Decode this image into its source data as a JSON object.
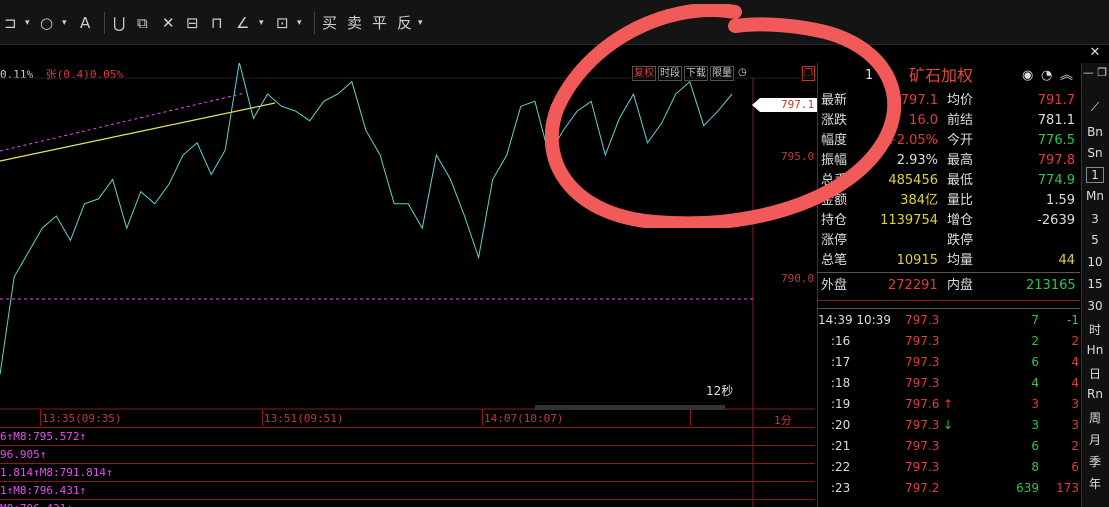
{
  "toolbar": {
    "trade_buttons": [
      "买",
      "卖",
      "平",
      "反"
    ]
  },
  "chart": {
    "header_pct": "0.11%",
    "header_zhang": "张(0.4)0.05%",
    "mini_buttons": [
      "复权",
      "时段",
      "下载",
      "限量"
    ],
    "price_tag": "797.1",
    "price_axis": [
      "795.0",
      "790.0"
    ],
    "time_axis": [
      "13:35(09:35)",
      "13:51(09:51)",
      "14:07(10:07)",
      "1分"
    ],
    "countdown": "12秒",
    "indicator_rows": [
      "6↑M8:795.572↑",
      "96.905↑",
      "1.814↑M8:791.814↑",
      "1↑M8:796.431↑",
      "M8:796.431↑"
    ],
    "series": {
      "price": [
        786,
        790,
        791,
        792,
        792.5,
        791.5,
        793,
        793.2,
        794,
        792,
        793.5,
        793,
        793.8,
        795,
        795.5,
        794.2,
        795.2,
        798.8,
        796.5,
        797.5,
        797,
        796.8,
        796.4,
        797.2,
        797.5,
        798,
        796,
        795,
        793,
        793,
        792,
        795,
        794,
        792.5,
        790.8,
        794,
        795,
        797,
        797.2,
        795,
        796,
        796.8,
        797.2,
        795,
        796.5,
        797.5,
        795.5,
        796.3,
        797.5,
        798,
        796.2,
        796.8,
        797.5
      ]
    }
  },
  "panel": {
    "title_code": "1",
    "title_name": "矿石加权",
    "quotes": [
      {
        "l1": "最新",
        "v1": "797.1",
        "l2": "均价",
        "v2": "791.7",
        "c1": "red",
        "c2": "red"
      },
      {
        "l1": "涨跌",
        "v1": "16.0",
        "l2": "前结",
        "v2": "781.1",
        "c1": "red",
        "c2": "white"
      },
      {
        "l1": "幅度",
        "v1": "+2.05%",
        "l2": "今开",
        "v2": "776.5",
        "c1": "red",
        "c2": "green"
      },
      {
        "l1": "振幅",
        "v1": "2.93%",
        "l2": "最高",
        "v2": "797.8",
        "c1": "white",
        "c2": "red"
      },
      {
        "l1": "总手",
        "v1": "485456",
        "l2": "最低",
        "v2": "774.9",
        "c1": "yellow",
        "c2": "green"
      },
      {
        "l1": "金额",
        "v1": "384亿",
        "l2": "量比",
        "v2": "1.59",
        "c1": "yellow",
        "c2": "white"
      },
      {
        "l1": "持仓",
        "v1": "1139754",
        "l2": "增仓",
        "v2": "-2639",
        "c1": "yellow",
        "c2": "white"
      },
      {
        "l1": "涨停",
        "v1": "",
        "l2": "跌停",
        "v2": "",
        "c1": "white",
        "c2": "white"
      },
      {
        "l1": "总笔",
        "v1": "10915",
        "l2": "均量",
        "v2": "44",
        "c1": "yellow",
        "c2": "yellow"
      }
    ],
    "waipan_label": "外盘",
    "waipan_value": "272291",
    "neipan_label": "内盘",
    "neipan_value": "213165",
    "ticks": [
      {
        "time": "14:39 10:39",
        "price": "797.3",
        "arrow": "",
        "vol": "7",
        "chg": "-1",
        "pc": "red",
        "vc": "green",
        "cc": "green"
      },
      {
        "time": ":16",
        "price": "797.3",
        "arrow": "",
        "vol": "2",
        "chg": "2",
        "pc": "red",
        "vc": "green",
        "cc": "red"
      },
      {
        "time": ":17",
        "price": "797.3",
        "arrow": "",
        "vol": "6",
        "chg": "4",
        "pc": "red",
        "vc": "green",
        "cc": "red"
      },
      {
        "time": ":18",
        "price": "797.3",
        "arrow": "",
        "vol": "4",
        "chg": "4",
        "pc": "red",
        "vc": "green",
        "cc": "red"
      },
      {
        "time": ":19",
        "price": "797.6",
        "arrow": "↑",
        "vol": "3",
        "chg": "3",
        "pc": "red",
        "vc": "red",
        "cc": "red"
      },
      {
        "time": ":20",
        "price": "797.3",
        "arrow": "↓",
        "vol": "3",
        "chg": "3",
        "pc": "red",
        "vc": "green",
        "cc": "red"
      },
      {
        "time": ":21",
        "price": "797.3",
        "arrow": "",
        "vol": "6",
        "chg": "2",
        "pc": "red",
        "vc": "green",
        "cc": "red"
      },
      {
        "time": ":22",
        "price": "797.3",
        "arrow": "",
        "vol": "8",
        "chg": "6",
        "pc": "red",
        "vc": "green",
        "cc": "red"
      },
      {
        "time": ":23",
        "price": "797.2",
        "arrow": "",
        "vol": "639",
        "chg": "173",
        "pc": "red",
        "vc": "green",
        "cc": "red"
      }
    ]
  },
  "sidebar": {
    "items": [
      "Bn",
      "Sn",
      "1",
      "Mn",
      "3",
      "5",
      "10",
      "15",
      "30",
      "时",
      "Hn",
      "日",
      "Rn",
      "周",
      "月",
      "季",
      "年"
    ]
  },
  "colors": {
    "price_line": "#5fd3d3",
    "trend_line": "#e8e85a",
    "dash_line": "#e84ff0",
    "annotation": "#f25a5a"
  }
}
